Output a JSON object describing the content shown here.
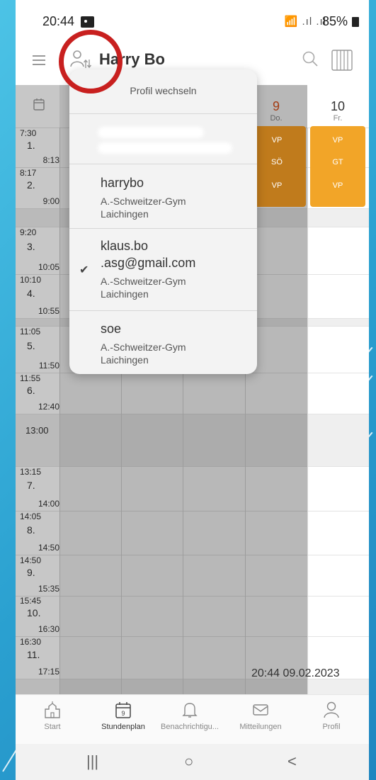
{
  "status_bar": {
    "time": "20:44",
    "signal": "📶 .ıl .ıl",
    "battery": "85%"
  },
  "header": {
    "title": "Harry Bo"
  },
  "days": [
    {
      "num": "9",
      "name": "Do.",
      "today": true
    },
    {
      "num": "10",
      "name": "Fr.",
      "today": false
    }
  ],
  "periods": [
    {
      "start": "7:30",
      "n": "1.",
      "end": "8:13"
    },
    {
      "start": "8:17",
      "n": "2.",
      "end": "9:00"
    },
    {
      "start": "9:20",
      "n": "3.",
      "end": "10:05"
    },
    {
      "start": "10:10",
      "n": "4.",
      "end": "10:55"
    },
    {
      "start": "11:05",
      "n": "5.",
      "end": "11:50"
    },
    {
      "start": "11:55",
      "n": "6.",
      "end": "12:40"
    },
    {
      "start": "13:15",
      "n": "7.",
      "end": "14:00"
    },
    {
      "start": "14:05",
      "n": "8.",
      "end": "14:50"
    },
    {
      "start": "14:50",
      "n": "9.",
      "end": "15:35"
    },
    {
      "start": "15:45",
      "n": "10.",
      "end": "16:30"
    },
    {
      "start": "16:30",
      "n": "11.",
      "end": "17:15"
    }
  ],
  "break_label": "13:00",
  "lessons": {
    "thursday": [
      "VP",
      "SÖ",
      "VP"
    ],
    "friday": [
      "VP",
      "GT",
      "VP"
    ]
  },
  "last_updated": "20:44 09.02.2023",
  "dropdown": {
    "title": "Profil wechseln",
    "profiles": [
      {
        "user": "harrybo",
        "school_line1": "A.-Schweitzer-Gym",
        "school_line2": "Laichingen",
        "selected": false
      },
      {
        "user_line1": "klaus.bo",
        "user_line2": ".asg@gmail.com",
        "school_line1": "A.-Schweitzer-Gym",
        "school_line2": "Laichingen",
        "selected": true
      },
      {
        "user": "soe",
        "school_line1": "A.-Schweitzer-Gym",
        "school_line2": "Laichingen",
        "selected": false
      }
    ],
    "check": "✔"
  },
  "bottom_nav": [
    {
      "label": "Start",
      "icon": "school-icon"
    },
    {
      "label": "Stundenplan",
      "icon": "calendar-icon",
      "calendar_day": "9",
      "active": true
    },
    {
      "label": "Benachrichtigu...",
      "icon": "bell-icon"
    },
    {
      "label": "Mitteilungen",
      "icon": "envelope-icon"
    },
    {
      "label": "Profil",
      "icon": "person-icon"
    }
  ],
  "system_nav": {
    "recents": "|||",
    "home": "○",
    "back": "<"
  },
  "colors": {
    "accent": "#f2a528",
    "today": "#e2541c",
    "ring": "#c8201f"
  }
}
